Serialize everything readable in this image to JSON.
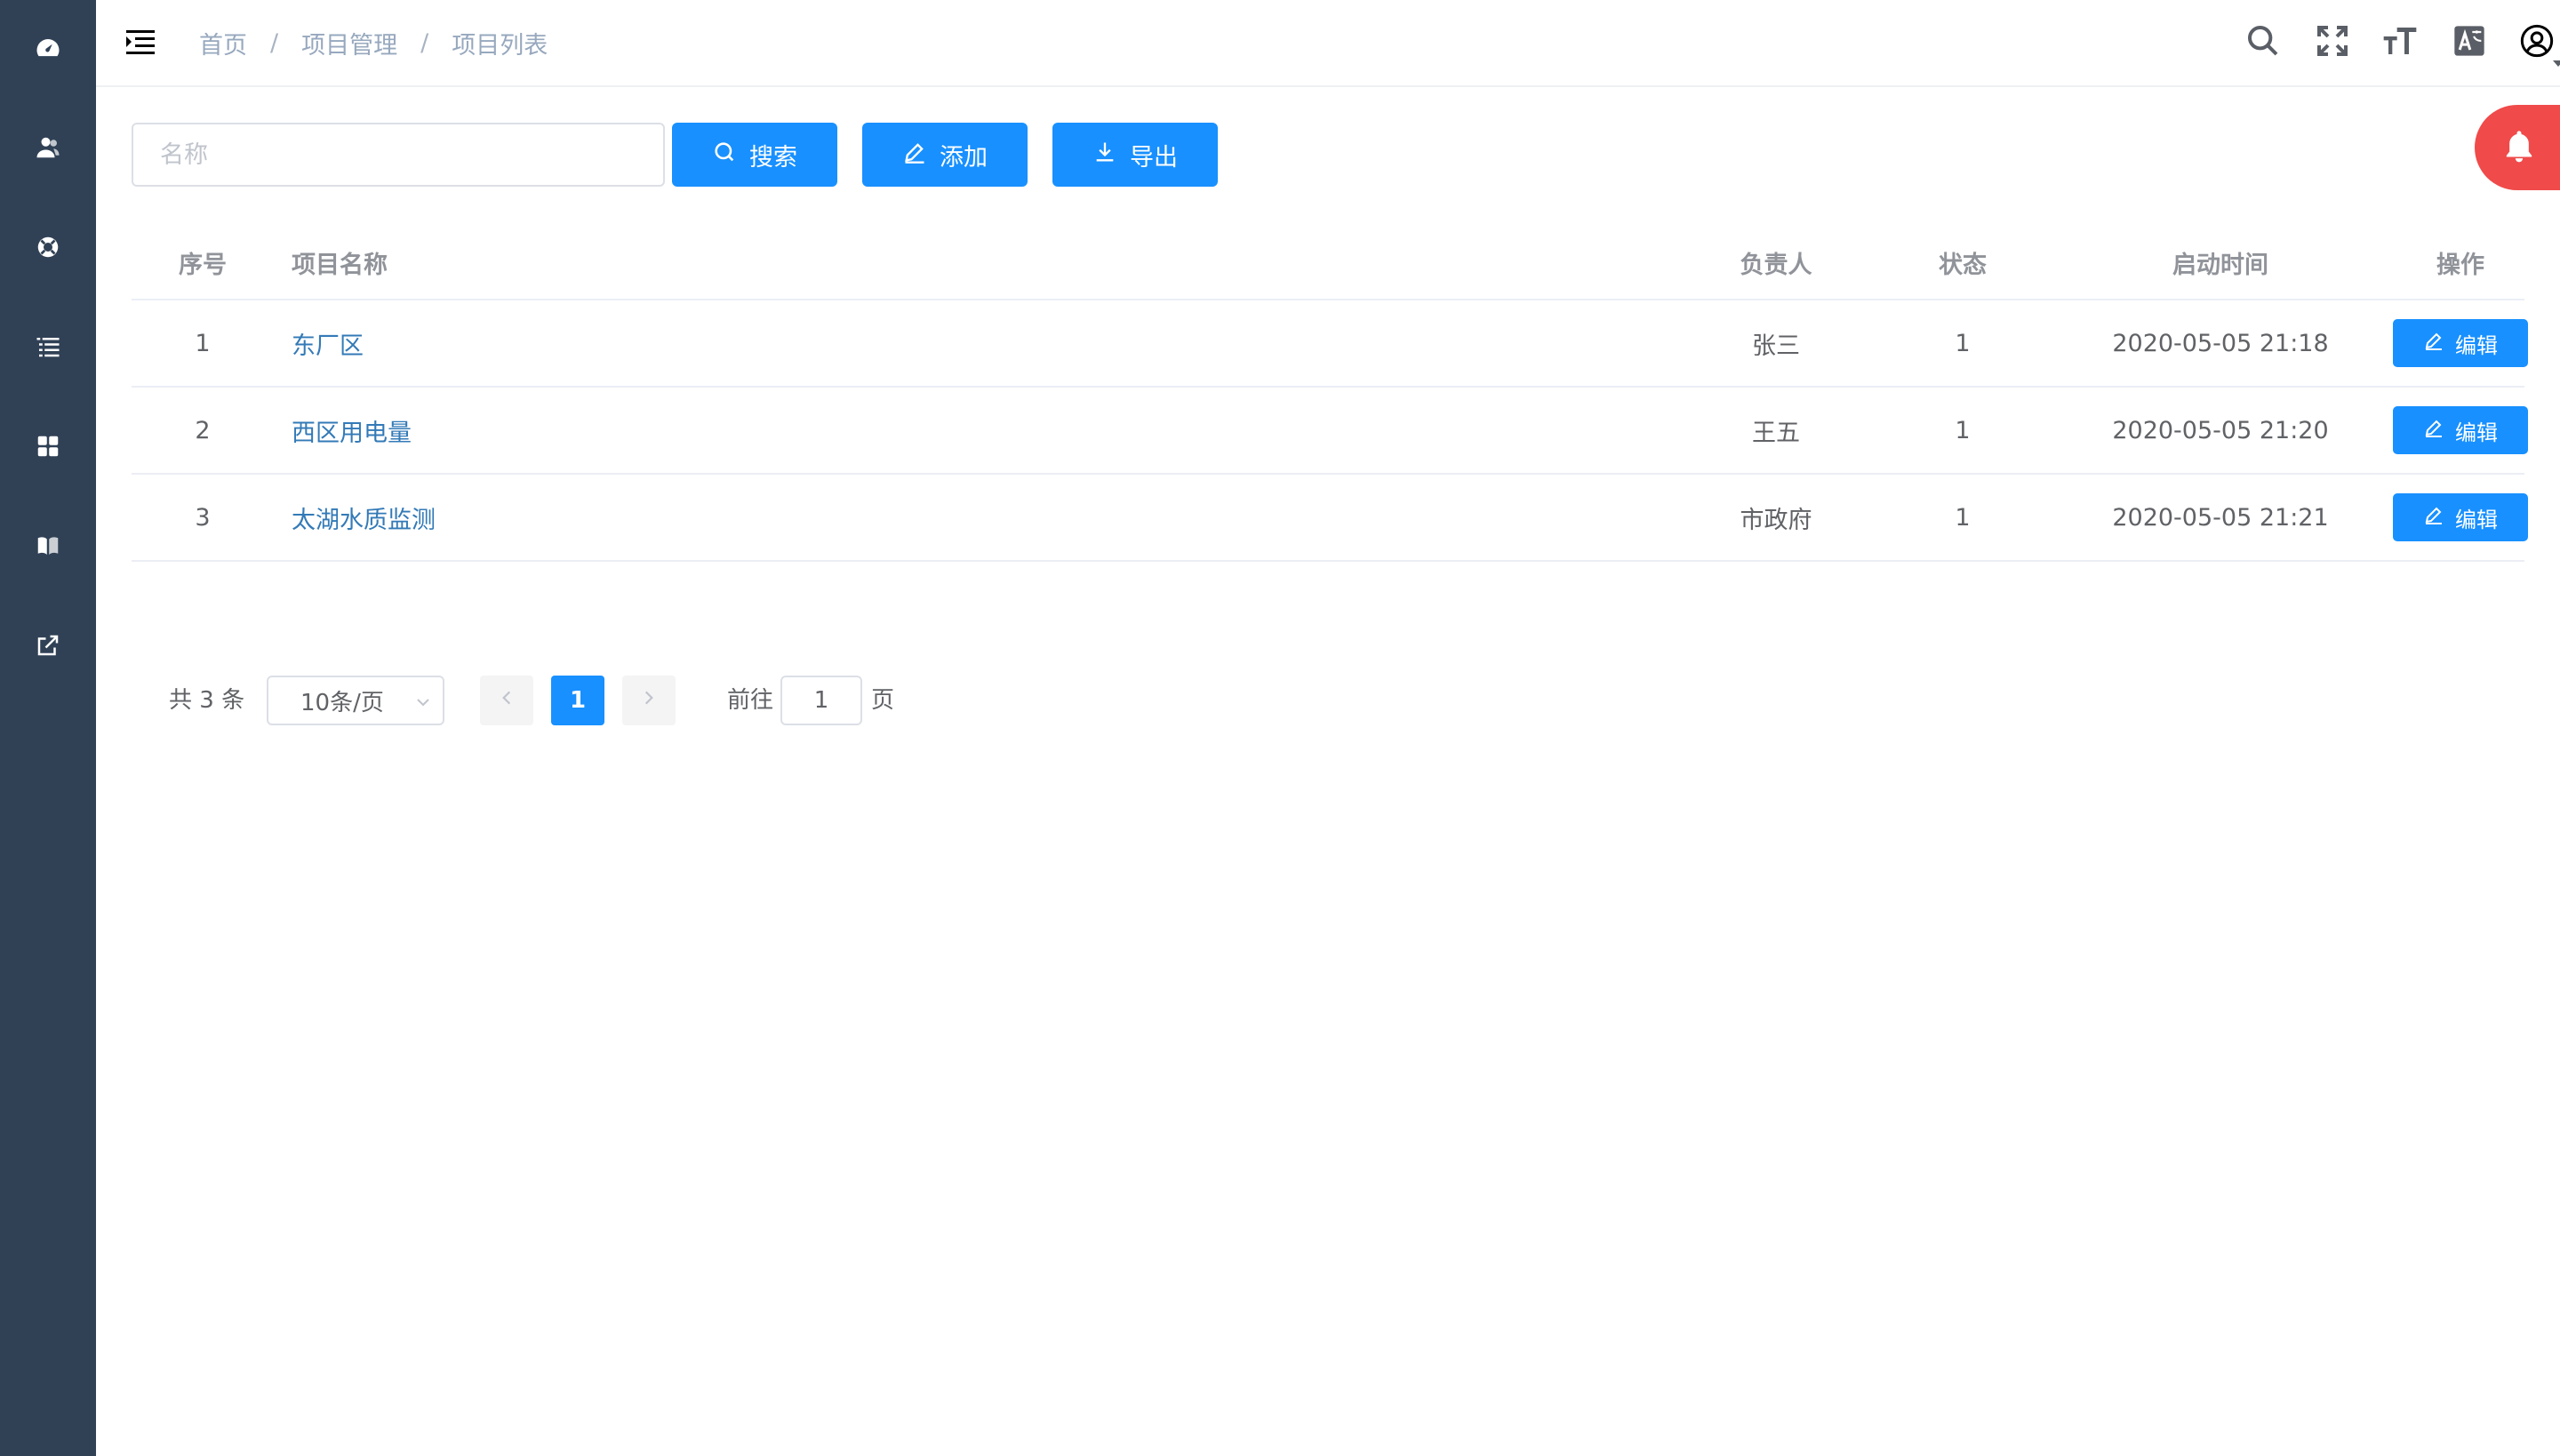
{
  "colors": {
    "sidebar_bg": "#304156",
    "primary": "#1890ff",
    "link": "#337ab7",
    "bell": "#f04a4a"
  },
  "sidebar": {
    "items": [
      {
        "icon": "dashboard-icon"
      },
      {
        "icon": "users-icon"
      },
      {
        "icon": "lifebuoy-icon"
      },
      {
        "icon": "list-icon"
      },
      {
        "icon": "grid-icon"
      },
      {
        "icon": "book-icon"
      },
      {
        "icon": "external-link-icon"
      }
    ]
  },
  "navbar": {
    "breadcrumb": [
      "首页",
      "项目管理",
      "项目列表"
    ],
    "separator": "/",
    "icons": [
      "search-icon",
      "fullscreen-icon",
      "font-size-icon",
      "translate-icon",
      "user-avatar-icon"
    ]
  },
  "toolbar": {
    "search_placeholder": "名称",
    "search_value": "",
    "search_label": "搜索",
    "add_label": "添加",
    "export_label": "导出"
  },
  "table": {
    "headers": {
      "index": "序号",
      "name": "项目名称",
      "owner": "负责人",
      "status": "状态",
      "start_time": "启动时间",
      "action": "操作"
    },
    "rows": [
      {
        "index": "1",
        "name": "东厂区",
        "owner": "张三",
        "status": "1",
        "start_time": "2020-05-05 21:18",
        "action": "编辑"
      },
      {
        "index": "2",
        "name": "西区用电量",
        "owner": "王五",
        "status": "1",
        "start_time": "2020-05-05 21:20",
        "action": "编辑"
      },
      {
        "index": "3",
        "name": "太湖水质监测",
        "owner": "市政府",
        "status": "1",
        "start_time": "2020-05-05 21:21",
        "action": "编辑"
      }
    ]
  },
  "pagination": {
    "total_text": "共 3 条",
    "page_size": "10条/页",
    "current_page": "1",
    "goto_label": "前往",
    "goto_value": "1",
    "page_suffix": "页"
  }
}
